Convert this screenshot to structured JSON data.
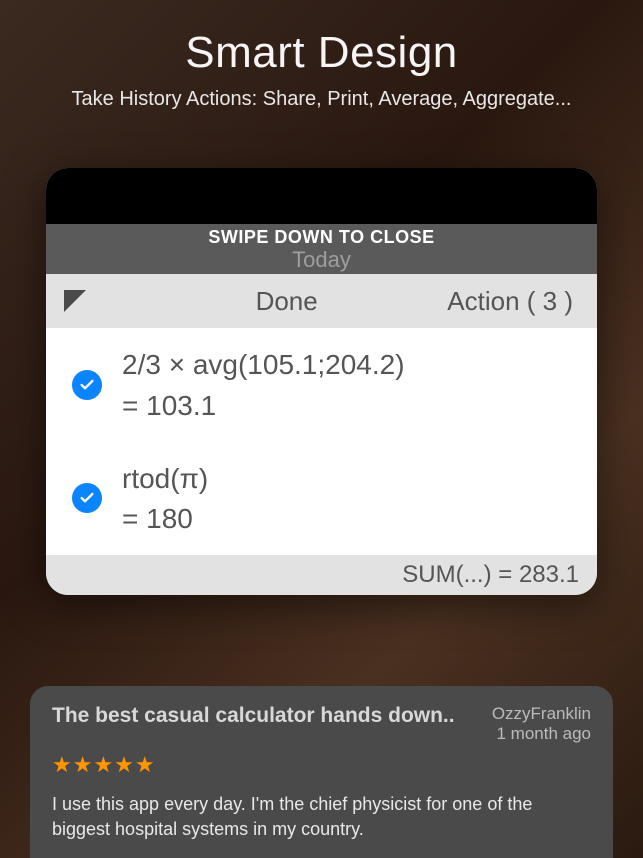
{
  "hero": {
    "title": "Smart Design",
    "subtitle": "Take History Actions: Share, Print, Average, Aggregate..."
  },
  "card": {
    "swipe_label": "SWIPE DOWN TO CLOSE",
    "day_label": "Today",
    "done_label": "Done",
    "action_label": "Action ( 3 )",
    "items": [
      {
        "expression": "2/3 × avg(105.1;204.2)",
        "result": "= 103.1"
      },
      {
        "expression": "rtod(π)",
        "result": "= 180"
      }
    ],
    "sum_label": "SUM(...) = 283.1"
  },
  "review": {
    "title": "The best casual calculator hands down..",
    "author": "OzzyFranklin",
    "date": "1 month ago",
    "stars": "★★★★★",
    "body": "I use this app every day. I'm the chief physicist for one of the biggest hospital systems in my country."
  }
}
